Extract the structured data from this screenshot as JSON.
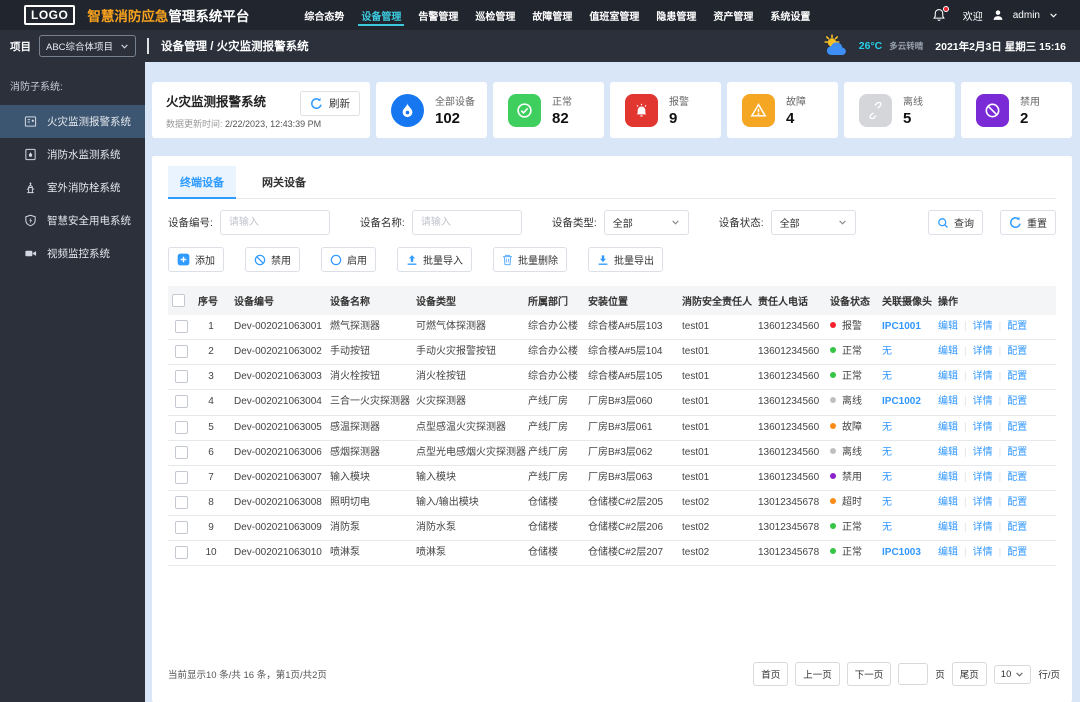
{
  "topbar": {
    "logo": "LOGO",
    "title_highlight": "智慧消防应急",
    "title_rest": "管理系统平台",
    "nav": [
      {
        "label": "综合态势",
        "active": false
      },
      {
        "label": "设备管理",
        "active": true
      },
      {
        "label": "告警管理",
        "active": false
      },
      {
        "label": "巡检管理",
        "active": false
      },
      {
        "label": "故障管理",
        "active": false
      },
      {
        "label": "值班室管理",
        "active": false
      },
      {
        "label": "隐患管理",
        "active": false
      },
      {
        "label": "资产管理",
        "active": false
      },
      {
        "label": "系统设置",
        "active": false
      }
    ],
    "welcome": "欢迎",
    "user": "admin",
    "accent": "#3cc9de",
    "title_accent": "#f8a21d"
  },
  "subheader": {
    "project_label": "项目",
    "project_value": "ABC综合体项目",
    "breadcrumb": "设备管理 / 火灾监测报警系统",
    "temperature": "26°C",
    "weather": "多云转晴",
    "datetime": "2021年2月3日 星期三 15:16"
  },
  "sidebar": {
    "group_label": "消防子系统:",
    "items": [
      {
        "label": "火灾监测报警系统",
        "icon": "fire-alarm-panel-icon",
        "active": true
      },
      {
        "label": "消防水监测系统",
        "icon": "water-monitor-icon",
        "active": false
      },
      {
        "label": "室外消防栓系统",
        "icon": "hydrant-icon",
        "active": false
      },
      {
        "label": "智慧安全用电系统",
        "icon": "shield-bolt-icon",
        "active": false
      },
      {
        "label": "视频监控系统",
        "icon": "video-camera-icon",
        "active": false
      }
    ]
  },
  "overview": {
    "title": "火灾监测报警系统",
    "refresh_label": "刷新",
    "update_label": "数据更新时间:",
    "update_value": "2/22/2023, 12:43:39 PM",
    "stats": [
      {
        "label": "全部设备",
        "value": "102",
        "icon": "flame-icon",
        "color": "#1677f0",
        "shape": "circle"
      },
      {
        "label": "正常",
        "value": "82",
        "icon": "check-circle-icon",
        "color": "#3ecf5f",
        "shape": "square"
      },
      {
        "label": "报警",
        "value": "9",
        "icon": "alarm-bell-icon",
        "color": "#e23730",
        "shape": "square"
      },
      {
        "label": "故障",
        "value": "4",
        "icon": "warning-triangle-icon",
        "color": "#f5a623",
        "shape": "square"
      },
      {
        "label": "离线",
        "value": "5",
        "icon": "broken-link-icon",
        "color": "#d4d6d9",
        "shape": "square"
      },
      {
        "label": "禁用",
        "value": "2",
        "icon": "no-entry-icon",
        "color": "#7b2bd6",
        "shape": "square"
      }
    ]
  },
  "tabs": [
    {
      "label": "终端设备",
      "active": true
    },
    {
      "label": "网关设备",
      "active": false
    }
  ],
  "filters": {
    "device_no_label": "设备编号:",
    "device_no_placeholder": "请输入",
    "device_name_label": "设备名称:",
    "device_name_placeholder": "请输入",
    "device_type_label": "设备类型:",
    "device_type_value": "全部",
    "device_status_label": "设备状态:",
    "device_status_value": "全部",
    "search_label": "查询",
    "reset_label": "重置"
  },
  "actions": [
    {
      "label": "添加",
      "icon": "plus-square-icon"
    },
    {
      "label": "禁用",
      "icon": "ban-icon"
    },
    {
      "label": "启用",
      "icon": "ring-icon"
    },
    {
      "label": "批量导入",
      "icon": "upload-icon"
    },
    {
      "label": "批量删除",
      "icon": "trash-icon"
    },
    {
      "label": "批量导出",
      "icon": "download-icon"
    }
  ],
  "table": {
    "columns": [
      "序号",
      "设备编号",
      "设备名称",
      "设备类型",
      "所属部门",
      "安装位置",
      "消防安全责任人",
      "责任人电话",
      "设备状态",
      "关联摄像头",
      "操作"
    ],
    "action_links": [
      "编辑",
      "详情",
      "配置"
    ],
    "status_colors": {
      "报警": "#f5222d",
      "正常": "#35c445",
      "离线": "#c0c0c0",
      "故障": "#fa8c16",
      "超时": "#fa8c16",
      "禁用": "#8b22c9"
    },
    "link_color": "#3197ff",
    "rows": [
      {
        "index": "1",
        "code": "Dev-002021063001",
        "name": "燃气探测器",
        "type": "可燃气体探测器",
        "dept": "综合办公楼",
        "location": "综合楼A#5层103",
        "owner": "test01",
        "phone": "13601234560",
        "status": "报警",
        "camera": "IPC1001"
      },
      {
        "index": "2",
        "code": "Dev-002021063002",
        "name": "手动按钮",
        "type": "手动火灾报警按钮",
        "dept": "综合办公楼",
        "location": "综合楼A#5层104",
        "owner": "test01",
        "phone": "13601234560",
        "status": "正常",
        "camera": "无"
      },
      {
        "index": "3",
        "code": "Dev-002021063003",
        "name": "消火栓按钮",
        "type": "消火栓按钮",
        "dept": "综合办公楼",
        "location": "综合楼A#5层105",
        "owner": "test01",
        "phone": "13601234560",
        "status": "正常",
        "camera": "无"
      },
      {
        "index": "4",
        "code": "Dev-002021063004",
        "name": "三合一火灾探测器",
        "type": "火灾探测器",
        "dept": "产线厂房",
        "location": "厂房B#3层060",
        "owner": "test01",
        "phone": "13601234560",
        "status": "离线",
        "camera": "IPC1002"
      },
      {
        "index": "5",
        "code": "Dev-002021063005",
        "name": "感温探测器",
        "type": "点型感温火灾探测器",
        "dept": "产线厂房",
        "location": "厂房B#3层061",
        "owner": "test01",
        "phone": "13601234560",
        "status": "故障",
        "camera": "无"
      },
      {
        "index": "6",
        "code": "Dev-002021063006",
        "name": "感烟探测器",
        "type": "点型光电感烟火灾探测器",
        "dept": "产线厂房",
        "location": "厂房B#3层062",
        "owner": "test01",
        "phone": "13601234560",
        "status": "离线",
        "camera": "无"
      },
      {
        "index": "7",
        "code": "Dev-002021063007",
        "name": "输入模块",
        "type": "输入模块",
        "dept": "产线厂房",
        "location": "厂房B#3层063",
        "owner": "test01",
        "phone": "13601234560",
        "status": "禁用",
        "camera": "无"
      },
      {
        "index": "8",
        "code": "Dev-002021063008",
        "name": "照明切电",
        "type": "输入/输出模块",
        "dept": "仓储楼",
        "location": "仓储楼C#2层205",
        "owner": "test02",
        "phone": "13012345678",
        "status": "超时",
        "camera": "无"
      },
      {
        "index": "9",
        "code": "Dev-002021063009",
        "name": "消防泵",
        "type": "消防水泵",
        "dept": "仓储楼",
        "location": "仓储楼C#2层206",
        "owner": "test02",
        "phone": "13012345678",
        "status": "正常",
        "camera": "无"
      },
      {
        "index": "10",
        "code": "Dev-002021063010",
        "name": "喷淋泵",
        "type": "喷淋泵",
        "dept": "仓储楼",
        "location": "仓储楼C#2层207",
        "owner": "test02",
        "phone": "13012345678",
        "status": "正常",
        "camera": "IPC1003"
      }
    ]
  },
  "pagination": {
    "summary": "当前显示10 条/共 16 条，第1页/共2页",
    "first_label": "首页",
    "prev_label": "上一页",
    "next_label": "下一页",
    "page_suffix": "页",
    "last_label": "尾页",
    "page_size": "10",
    "per_page_label": "行/页"
  }
}
